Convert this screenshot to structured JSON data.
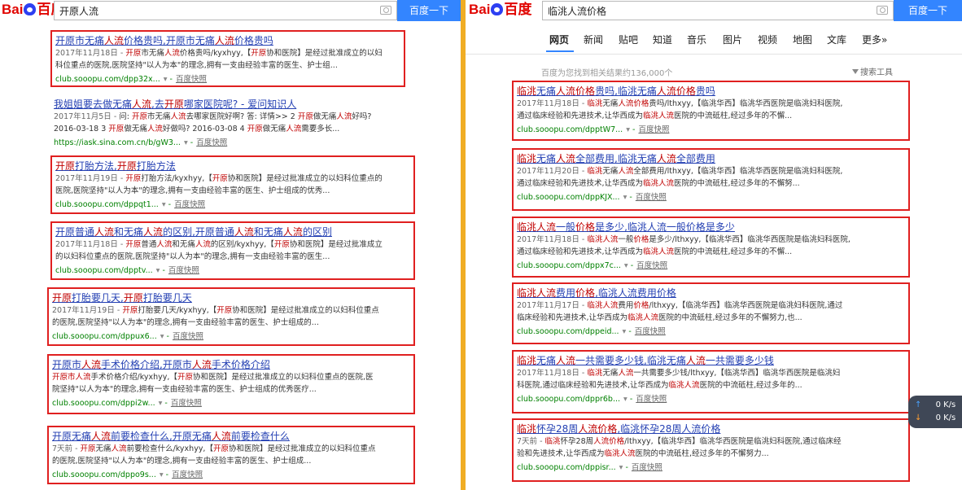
{
  "left": {
    "logo": {
      "bai": "Bai",
      "du": "百度"
    },
    "query": "开原人流",
    "search_button": "百度一下",
    "results": [
      {
        "title": [
          {
            "t": "开原市无痛"
          },
          {
            "t": "人流",
            "h": true
          },
          {
            "t": "价格贵吗,开原市无痛"
          },
          {
            "t": "人流",
            "h": true
          },
          {
            "t": "价格贵吗"
          }
        ],
        "lines": [
          [
            {
              "t": "2017年11月18日 - ",
              "d": true
            },
            {
              "t": "开原",
              "h": true
            },
            {
              "t": "市无痛"
            },
            {
              "t": "人流",
              "h": true
            },
            {
              "t": "价格贵吗/kyxhyy,【"
            },
            {
              "t": "开原",
              "h": true
            },
            {
              "t": "协和医院】是经过批准成立的以妇"
            }
          ],
          [
            {
              "t": "科位重点的医院,医院坚持\"以人为本\"的理念,拥有一支由经验丰富的医生、护士组..."
            }
          ]
        ],
        "url": "club.sooopu.com/dpp32x...",
        "snapshot": "百度快照",
        "boxed": true
      },
      {
        "title": [
          {
            "t": "我姐姐要去做无痛"
          },
          {
            "t": "人流",
            "h": true
          },
          {
            "t": ",去"
          },
          {
            "t": "开原",
            "h": true
          },
          {
            "t": "哪家医院呢? - 爱问知识人"
          }
        ],
        "lines": [
          [
            {
              "t": "2017年11月5日 - ",
              "d": true
            },
            {
              "t": "问: "
            },
            {
              "t": "开原",
              "h": true
            },
            {
              "t": "市无痛"
            },
            {
              "t": "人流",
              "h": true
            },
            {
              "t": "去哪家医院好啊? 答: 详情>> 2 "
            },
            {
              "t": "开原",
              "h": true
            },
            {
              "t": "做无痛"
            },
            {
              "t": "人流",
              "h": true
            },
            {
              "t": "好吗?"
            }
          ],
          [
            {
              "t": "2016-03-18 3 "
            },
            {
              "t": "开原",
              "h": true
            },
            {
              "t": "做无痛"
            },
            {
              "t": "人流",
              "h": true
            },
            {
              "t": "好做吗? 2016-03-08 4 "
            },
            {
              "t": "开原",
              "h": true
            },
            {
              "t": "做无痛"
            },
            {
              "t": "人流",
              "h": true
            },
            {
              "t": "需要多长..."
            }
          ]
        ],
        "url": "https://iask.sina.com.cn/b/gW3...",
        "snapshot": "百度快照",
        "boxed": false
      },
      {
        "title": [
          {
            "t": "开原",
            "h": true
          },
          {
            "t": "打胎方法,"
          },
          {
            "t": "开原",
            "h": true
          },
          {
            "t": "打胎方法"
          }
        ],
        "lines": [
          [
            {
              "t": "2017年11月19日 - ",
              "d": true
            },
            {
              "t": "开原",
              "h": true
            },
            {
              "t": "打胎方法/kyxhyy,【"
            },
            {
              "t": "开原",
              "h": true
            },
            {
              "t": "协和医院】是经过批准成立的以妇科位重点的"
            }
          ],
          [
            {
              "t": "医院,医院坚持\"以人为本\"的理念,拥有一支由经验丰富的医生、护士组成的优秀..."
            }
          ]
        ],
        "url": "club.sooopu.com/dppqt1...",
        "snapshot": "百度快照",
        "boxed": true
      },
      {
        "title": [
          {
            "t": "开原普通"
          },
          {
            "t": "人流",
            "h": true
          },
          {
            "t": "和无痛"
          },
          {
            "t": "人流",
            "h": true
          },
          {
            "t": "的区别,开原普通"
          },
          {
            "t": "人流",
            "h": true
          },
          {
            "t": "和无痛"
          },
          {
            "t": "人流",
            "h": true
          },
          {
            "t": "的区别"
          }
        ],
        "lines": [
          [
            {
              "t": "2017年11月18日 - ",
              "d": true
            },
            {
              "t": "开原",
              "h": true
            },
            {
              "t": "普通"
            },
            {
              "t": "人流",
              "h": true
            },
            {
              "t": "和无痛"
            },
            {
              "t": "人流",
              "h": true
            },
            {
              "t": "的区别/kyxhyy,【"
            },
            {
              "t": "开原",
              "h": true
            },
            {
              "t": "协和医院】是经过批准成立"
            }
          ],
          [
            {
              "t": "的以妇科位重点的医院,医院坚持\"以人为本\"的理念,拥有一支由经验丰富的医生..."
            }
          ]
        ],
        "url": "club.sooopu.com/dpptv...",
        "snapshot": "百度快照",
        "boxed": true
      },
      {
        "title": [
          {
            "t": "开原",
            "h": true
          },
          {
            "t": "打胎要几天,"
          },
          {
            "t": "开原",
            "h": true
          },
          {
            "t": "打胎要几天"
          }
        ],
        "lines": [
          [
            {
              "t": "2017年11月19日 - ",
              "d": true
            },
            {
              "t": "开原",
              "h": true
            },
            {
              "t": "打胎要几天/kyxhyy,【"
            },
            {
              "t": "开原",
              "h": true
            },
            {
              "t": "协和医院】是经过批准成立的以妇科位重点"
            }
          ],
          [
            {
              "t": "的医院,医院坚持\"以人为本\"的理念,拥有一支由经验丰富的医生、护士组成的..."
            }
          ]
        ],
        "url": "club.sooopu.com/dppux6...",
        "snapshot": "百度快照",
        "boxed": true
      },
      {
        "title": [
          {
            "t": "开原市"
          },
          {
            "t": "人流",
            "h": true
          },
          {
            "t": "手术价格介绍,开原市"
          },
          {
            "t": "人流",
            "h": true
          },
          {
            "t": "手术价格介绍"
          }
        ],
        "lines": [
          [
            {
              "t": "开原市",
              "h": true
            },
            {
              "t": "人流",
              "h": true
            },
            {
              "t": "手术价格介绍/kyxhyy,【"
            },
            {
              "t": "开原",
              "h": true
            },
            {
              "t": "协和医院】是经过批准成立的以妇科位重点的医院,医"
            }
          ],
          [
            {
              "t": "院坚持\"以人为本\"的理念,拥有一支由经验丰富的医生、护士组成的优秀医疗..."
            }
          ]
        ],
        "url": "club.sooopu.com/dppi2w...",
        "snapshot": "百度快照",
        "boxed": true
      },
      {
        "title": [
          {
            "t": "开原无痛"
          },
          {
            "t": "人流",
            "h": true
          },
          {
            "t": "前要检查什么,开原无痛"
          },
          {
            "t": "人流",
            "h": true
          },
          {
            "t": "前要检查什么"
          }
        ],
        "lines": [
          [
            {
              "t": "7天前 - ",
              "d": true
            },
            {
              "t": "开原",
              "h": true
            },
            {
              "t": "无痛"
            },
            {
              "t": "人流",
              "h": true
            },
            {
              "t": "前要检查什么/kyxhyy,【"
            },
            {
              "t": "开原",
              "h": true
            },
            {
              "t": "协和医院】是经过批准成立的以妇科位重点"
            }
          ],
          [
            {
              "t": "的医院,医院坚持\"以人为本\"的理念,拥有一支由经验丰富的医生、护士组成..."
            }
          ]
        ],
        "url": "club.sooopu.com/dppo9s...",
        "snapshot": "百度快照",
        "boxed": true
      }
    ]
  },
  "right": {
    "logo": {
      "bai": "Bai",
      "du": "百度"
    },
    "query": "临洮人流价格",
    "search_button": "百度一下",
    "nav": [
      "网页",
      "新闻",
      "贴吧",
      "知道",
      "音乐",
      "图片",
      "视频",
      "地图",
      "文库",
      "更多»"
    ],
    "active_nav": "网页",
    "result_count": "百度为您找到相关结果约136,000个",
    "tools": "搜索工具",
    "results": [
      {
        "title": [
          {
            "t": "临洮",
            "h": true
          },
          {
            "t": "无痛"
          },
          {
            "t": "人流",
            "h": true
          },
          {
            "t": "价格",
            "h": true
          },
          {
            "t": "贵吗,临洮无痛"
          },
          {
            "t": "人流",
            "h": true
          },
          {
            "t": "价格",
            "h": true
          },
          {
            "t": "贵吗"
          }
        ],
        "lines": [
          [
            {
              "t": "2017年11月18日 - ",
              "d": true
            },
            {
              "t": "临洮",
              "h": true
            },
            {
              "t": "无痛"
            },
            {
              "t": "人流价格",
              "h": true
            },
            {
              "t": "贵吗/lthxyy,【临洮华西】临洮华西医院是临洮妇科医院,"
            }
          ],
          [
            {
              "t": "通过临床经验和先进技术,让华西成为"
            },
            {
              "t": "临洮人流",
              "h": true
            },
            {
              "t": "医院的中流砥柱,经过多年的不懈..."
            }
          ]
        ],
        "url": "club.sooopu.com/dpptW7...",
        "snapshot": "百度快照"
      },
      {
        "title": [
          {
            "t": "临洮",
            "h": true
          },
          {
            "t": "无痛"
          },
          {
            "t": "人流",
            "h": true
          },
          {
            "t": "全部费用,临洮无痛"
          },
          {
            "t": "人流",
            "h": true
          },
          {
            "t": "全部费用"
          }
        ],
        "lines": [
          [
            {
              "t": "2017年11月20日 - ",
              "d": true
            },
            {
              "t": "临洮",
              "h": true
            },
            {
              "t": "无痛"
            },
            {
              "t": "人流",
              "h": true
            },
            {
              "t": "全部费用/lthxyy,【临洮华西】临洮华西医院是临洮妇科医院,"
            }
          ],
          [
            {
              "t": "通过临床经验和先进技术,让华西成为"
            },
            {
              "t": "临洮人流",
              "h": true
            },
            {
              "t": "医院的中流砥柱,经过多年的不懈努..."
            }
          ]
        ],
        "url": "club.sooopu.com/dppKJX...",
        "snapshot": "百度快照"
      },
      {
        "title": [
          {
            "t": "临洮",
            "h": true
          },
          {
            "t": "人流",
            "h": true
          },
          {
            "t": "一般"
          },
          {
            "t": "价格",
            "h": true
          },
          {
            "t": "是多少,临洮人流一般价格是多少"
          }
        ],
        "lines": [
          [
            {
              "t": "2017年11月18日 - ",
              "d": true
            },
            {
              "t": "临洮",
              "h": true
            },
            {
              "t": "人流",
              "h": true
            },
            {
              "t": "一般"
            },
            {
              "t": "价格",
              "h": true
            },
            {
              "t": "是多少/lthxyy,【临洮华西】临洮华西医院是临洮妇科医院,"
            }
          ],
          [
            {
              "t": "通过临床经验和先进技术,让华西成为"
            },
            {
              "t": "临洮人流",
              "h": true
            },
            {
              "t": "医院的中流砥柱,经过多年的不懈..."
            }
          ]
        ],
        "url": "club.sooopu.com/dppx7c...",
        "snapshot": "百度快照"
      },
      {
        "title": [
          {
            "t": "临洮",
            "h": true
          },
          {
            "t": "人流",
            "h": true
          },
          {
            "t": "费用"
          },
          {
            "t": "价格",
            "h": true
          },
          {
            "t": ",临洮人流费用价格"
          }
        ],
        "lines": [
          [
            {
              "t": "2017年11月17日 - ",
              "d": true
            },
            {
              "t": "临洮",
              "h": true
            },
            {
              "t": "人流",
              "h": true
            },
            {
              "t": "费用"
            },
            {
              "t": "价格",
              "h": true
            },
            {
              "t": "/lthxyy,【临洮华西】临洮华西医院是临洮妇科医院,通过"
            }
          ],
          [
            {
              "t": "临床经验和先进技术,让华西成为"
            },
            {
              "t": "临洮人流",
              "h": true
            },
            {
              "t": "医院的中流砥柱,经过多年的不懈努力,也..."
            }
          ]
        ],
        "url": "club.sooopu.com/dppeid...",
        "snapshot": "百度快照"
      },
      {
        "title": [
          {
            "t": "临洮",
            "h": true
          },
          {
            "t": "无痛"
          },
          {
            "t": "人流",
            "h": true
          },
          {
            "t": "一共需要多少钱,临洮无痛"
          },
          {
            "t": "人流",
            "h": true
          },
          {
            "t": "一共需要多少钱"
          }
        ],
        "lines": [
          [
            {
              "t": "2017年11月18日 - ",
              "d": true
            },
            {
              "t": "临洮",
              "h": true
            },
            {
              "t": "无痛"
            },
            {
              "t": "人流",
              "h": true
            },
            {
              "t": "一共需要多少钱/lthxyy,【临洮华西】临洮华西医院是临洮妇"
            }
          ],
          [
            {
              "t": "科医院,通过临床经验和先进技术,让华西成为"
            },
            {
              "t": "临洮人流",
              "h": true
            },
            {
              "t": "医院的中流砥柱,经过多年的..."
            }
          ]
        ],
        "url": "club.sooopu.com/dppr6b...",
        "snapshot": "百度快照"
      },
      {
        "title": [
          {
            "t": "临洮",
            "h": true
          },
          {
            "t": "怀孕28周"
          },
          {
            "t": "人流价格",
            "h": true
          },
          {
            "t": ",临洮怀孕28周人流价格"
          }
        ],
        "lines": [
          [
            {
              "t": "7天前 - ",
              "d": true
            },
            {
              "t": "临洮",
              "h": true
            },
            {
              "t": "怀孕28周"
            },
            {
              "t": "人流价格",
              "h": true
            },
            {
              "t": "/lthxyy,【临洮华西】临洮华西医院是临洮妇科医院,通过临床经"
            }
          ],
          [
            {
              "t": "验和先进技术,让华西成为"
            },
            {
              "t": "临洮人流",
              "h": true
            },
            {
              "t": "医院的中流砥柱,经过多年的不懈努力..."
            }
          ]
        ],
        "url": "club.sooopu.com/dppisr...",
        "snapshot": "百度快照"
      }
    ]
  },
  "net_widget": {
    "up": "0 K/s",
    "down": "0 K/s",
    "up_arrow": "↑",
    "down_arrow": "↓"
  },
  "colors": {
    "highlight": "#c00000",
    "link": "#2440b3",
    "url": "#008000",
    "box": "#e02020",
    "divider": "#f0ad24",
    "button": "#3385ff"
  }
}
